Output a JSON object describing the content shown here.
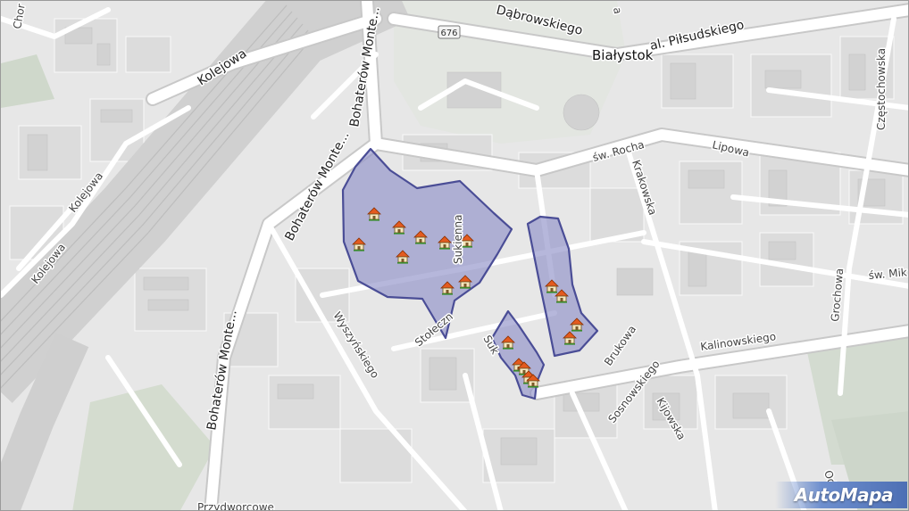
{
  "map": {
    "city_label": "Białystok",
    "route_shield": "676",
    "streets": [
      {
        "id": "chor",
        "text": "Chor"
      },
      {
        "id": "kolejowa-1",
        "text": "Kolejowa"
      },
      {
        "id": "kolejowa-2",
        "text": "Kolejowa"
      },
      {
        "id": "kolejowa-3",
        "text": "Kolejowa"
      },
      {
        "id": "bohaterow-1",
        "text": "Bohaterów Monte..."
      },
      {
        "id": "bohaterow-2",
        "text": "Bohaterów Monte..."
      },
      {
        "id": "bohaterow-3",
        "text": "Bohaterów Monte..."
      },
      {
        "id": "dabrowskiego",
        "text": "Dąbrowskiego"
      },
      {
        "id": "pilsudskiego",
        "text": "al. Piłsudskiego"
      },
      {
        "id": "top-a",
        "text": "a"
      },
      {
        "id": "czestochowska",
        "text": "Częstochowska"
      },
      {
        "id": "sw-rocha",
        "text": "św. Rocha"
      },
      {
        "id": "lipowa",
        "text": "Lipowa"
      },
      {
        "id": "krakowska",
        "text": "Krakowska"
      },
      {
        "id": "sukienna-1",
        "text": "Sukienna"
      },
      {
        "id": "sukienna-2",
        "text": "Suk"
      },
      {
        "id": "stolecz",
        "text": "Stołeczn"
      },
      {
        "id": "wyszynskiego",
        "text": "Wyszyńskiego"
      },
      {
        "id": "sw-mik",
        "text": "św. Mik"
      },
      {
        "id": "grochowa",
        "text": "Grochowa"
      },
      {
        "id": "brukowa",
        "text": "Brukowa"
      },
      {
        "id": "kalinowskiego",
        "text": "Kalinowskiego"
      },
      {
        "id": "sosnowskiego",
        "text": "Sosnowskiego"
      },
      {
        "id": "kijowska",
        "text": "Kijowska"
      },
      {
        "id": "przydworcowe",
        "text": "Przydworcowe"
      },
      {
        "id": "od",
        "text": "Od"
      }
    ],
    "area_fill": "#8f90c8",
    "area_stroke": "#4a4d96",
    "house_icon_count": 18
  },
  "brand": {
    "label": "AutoMapa"
  }
}
